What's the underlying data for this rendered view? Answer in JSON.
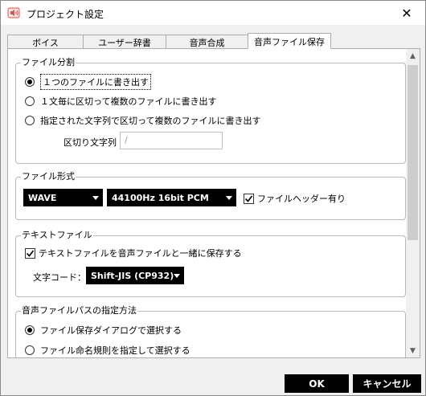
{
  "window": {
    "title": "プロジェクト設定",
    "close_label": "✕"
  },
  "tabs": [
    {
      "label": "ボイス"
    },
    {
      "label": "ユーザー辞書"
    },
    {
      "label": "音声合成"
    },
    {
      "label": "音声ファイル保存"
    }
  ],
  "file_split": {
    "title": "ファイル分割",
    "options": [
      "１つのファイルに書き出す",
      "１文毎に区切って複数のファイルに書き出す",
      "指定された文字列で区切って複数のファイルに書き出す"
    ],
    "selected_index": 0,
    "delimiter_label": "区切り文字列",
    "delimiter_value": "/"
  },
  "file_format": {
    "title": "ファイル形式",
    "format_value": "WAVE",
    "quality_value": "44100Hz 16bit PCM",
    "header_label": "ファイルヘッダー有り",
    "header_checked": true
  },
  "text_file": {
    "title": "テキストファイル",
    "save_label": "テキストファイルを音声ファイルと一緒に保存する",
    "save_checked": true,
    "encoding_label": "文字コード：",
    "encoding_value": "Shift-JIS (CP932)"
  },
  "path_spec": {
    "title": "音声ファイルパスの指定方法",
    "options": [
      "ファイル保存ダイアログで選択する",
      "ファイル命名規則を指定して選択する"
    ],
    "selected_index": 0
  },
  "buttons": {
    "ok": "OK",
    "cancel": "キャンセル"
  },
  "colors": {
    "accent": "#000000",
    "icon_red": "#d9534f"
  }
}
